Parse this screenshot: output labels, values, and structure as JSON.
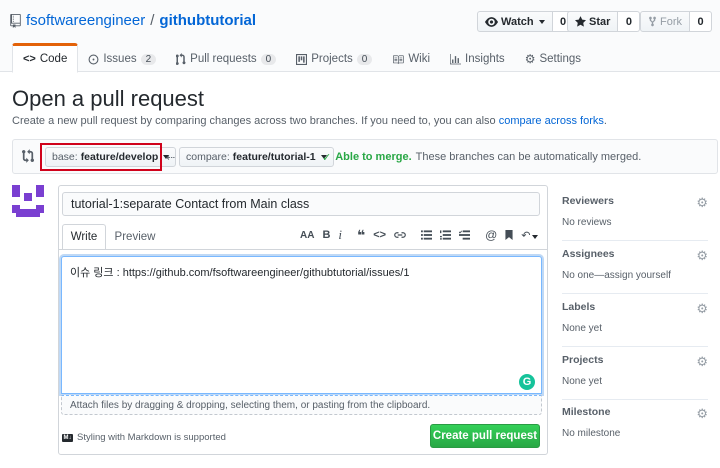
{
  "repo": {
    "owner": "fsoftwareengineer",
    "separator": "/",
    "name": "githubtutorial"
  },
  "header_buttons": [
    {
      "label": "Watch",
      "count": "0",
      "icon": "eye-icon"
    },
    {
      "label": "Star",
      "count": "0",
      "icon": "star-icon"
    },
    {
      "label": "Fork",
      "count": "0",
      "icon": "fork-icon"
    }
  ],
  "tabs": [
    {
      "label": "Code",
      "icon": "code-icon",
      "count": ""
    },
    {
      "label": "Issues",
      "icon": "issue-icon",
      "count": "2"
    },
    {
      "label": "Pull requests",
      "icon": "pull-request-icon",
      "count": "0"
    },
    {
      "label": "Projects",
      "icon": "project-icon",
      "count": "0"
    },
    {
      "label": "Wiki",
      "icon": "book-icon",
      "count": ""
    },
    {
      "label": "Insights",
      "icon": "graph-icon",
      "count": ""
    },
    {
      "label": "Settings",
      "icon": "gear-icon",
      "count": ""
    }
  ],
  "page": {
    "title": "Open a pull request",
    "description": "Create a new pull request by comparing changes across two branches. If you need to, you can also",
    "description_link": "compare across forks",
    "description_end": "."
  },
  "compare": {
    "base_prefix": "base:",
    "base_branch": "feature/develop",
    "compare_prefix": "compare:",
    "compare_branch": "feature/tutorial-1",
    "merge_status": "Able to merge.",
    "merge_detail": "These branches can be automatically merged."
  },
  "form": {
    "title_value": "tutorial-1:separate Contact from Main class",
    "write_tab": "Write",
    "preview_tab": "Preview",
    "body_value": "이슈 링크 : https://github.com/fsoftwareengineer/githubtutorial/issues/1",
    "attach_hint": "Attach files by dragging & dropping, selecting them, or pasting from the clipboard.",
    "markdown_note": "Styling with Markdown is supported",
    "submit_label": "Create pull request",
    "toolbar": [
      "AA",
      "B",
      "i",
      "❝",
      "<>",
      "link",
      "list-unordered",
      "list-ordered",
      "tasklist",
      "@",
      "bookmark",
      "reply"
    ]
  },
  "sidebar": [
    {
      "heading": "Reviewers",
      "value": "No reviews"
    },
    {
      "heading": "Assignees",
      "value": "No one—assign yourself"
    },
    {
      "heading": "Labels",
      "value": "None yet"
    },
    {
      "heading": "Projects",
      "value": "None yet"
    },
    {
      "heading": "Milestone",
      "value": "No milestone"
    }
  ],
  "colors": {
    "accent": "#0366d6",
    "tab_active": "#e36209",
    "success": "#28a745",
    "highlight": "#d0021b"
  }
}
